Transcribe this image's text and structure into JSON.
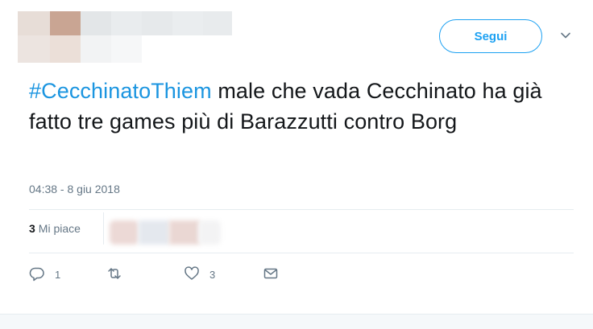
{
  "header": {
    "follow_label": "Segui"
  },
  "tweet": {
    "hashtag": "#CecchinatoThiem",
    "text": " male che vada Cecchinato ha già fatto tre games più di Barazzutti contro Borg",
    "timestamp": "04:38 - 8 giu 2018"
  },
  "stats": {
    "likes_count": "3",
    "likes_label": "Mi piace"
  },
  "actions": {
    "reply_count": "1",
    "retweet_count": "",
    "like_count": "3"
  },
  "colors": {
    "accent": "#1da1f2",
    "hashtag": "#1b95e0",
    "muted": "#657786"
  }
}
